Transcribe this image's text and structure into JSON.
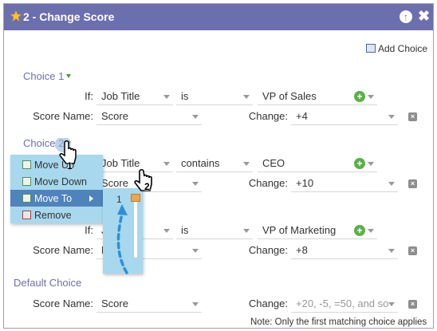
{
  "window": {
    "title": "2 - Change Score"
  },
  "toolbar": {
    "add_choice": "Add Choice"
  },
  "choice1": {
    "heading": "Choice 1",
    "if_label": "If:",
    "field": "Job Title",
    "operator": "is",
    "value": "VP of Sales",
    "score_name_label": "Score Name:",
    "score_name": "Score",
    "change_label": "Change:",
    "change": "+4"
  },
  "choice2": {
    "heading": "Choice 2",
    "field": "Job Title",
    "operator": "contains",
    "value": "CEO",
    "score_name": "Score",
    "change_label": "Change:",
    "change": "+10"
  },
  "choice3": {
    "if_label": "If:",
    "field": "J",
    "operator": "is",
    "value": "VP of Marketing",
    "score_name_label": "Score Name:",
    "score_name": "L",
    "change_label": "Change:",
    "change": "+8"
  },
  "default_choice": {
    "heading": "Default Choice",
    "score_name_label": "Score Name:",
    "score_name": "Score",
    "change_label": "Change:",
    "change_placeholder": "+20, -5, =50, and so"
  },
  "context_menu": {
    "items": [
      "Move Up",
      "Move Down",
      "Move To",
      "Remove"
    ],
    "highlighted": "Move To"
  },
  "move_to_submenu": {
    "position": "1"
  },
  "annotations": {
    "step1": "1",
    "step2": "2"
  },
  "footer": {
    "note": "Note: Only the first matching choice applies"
  },
  "colors": {
    "title_bar": "#6c6fae",
    "menu_bg": "#a7d8ee",
    "menu_highlight": "#4f83bb",
    "add_green": "#5cb04a"
  }
}
